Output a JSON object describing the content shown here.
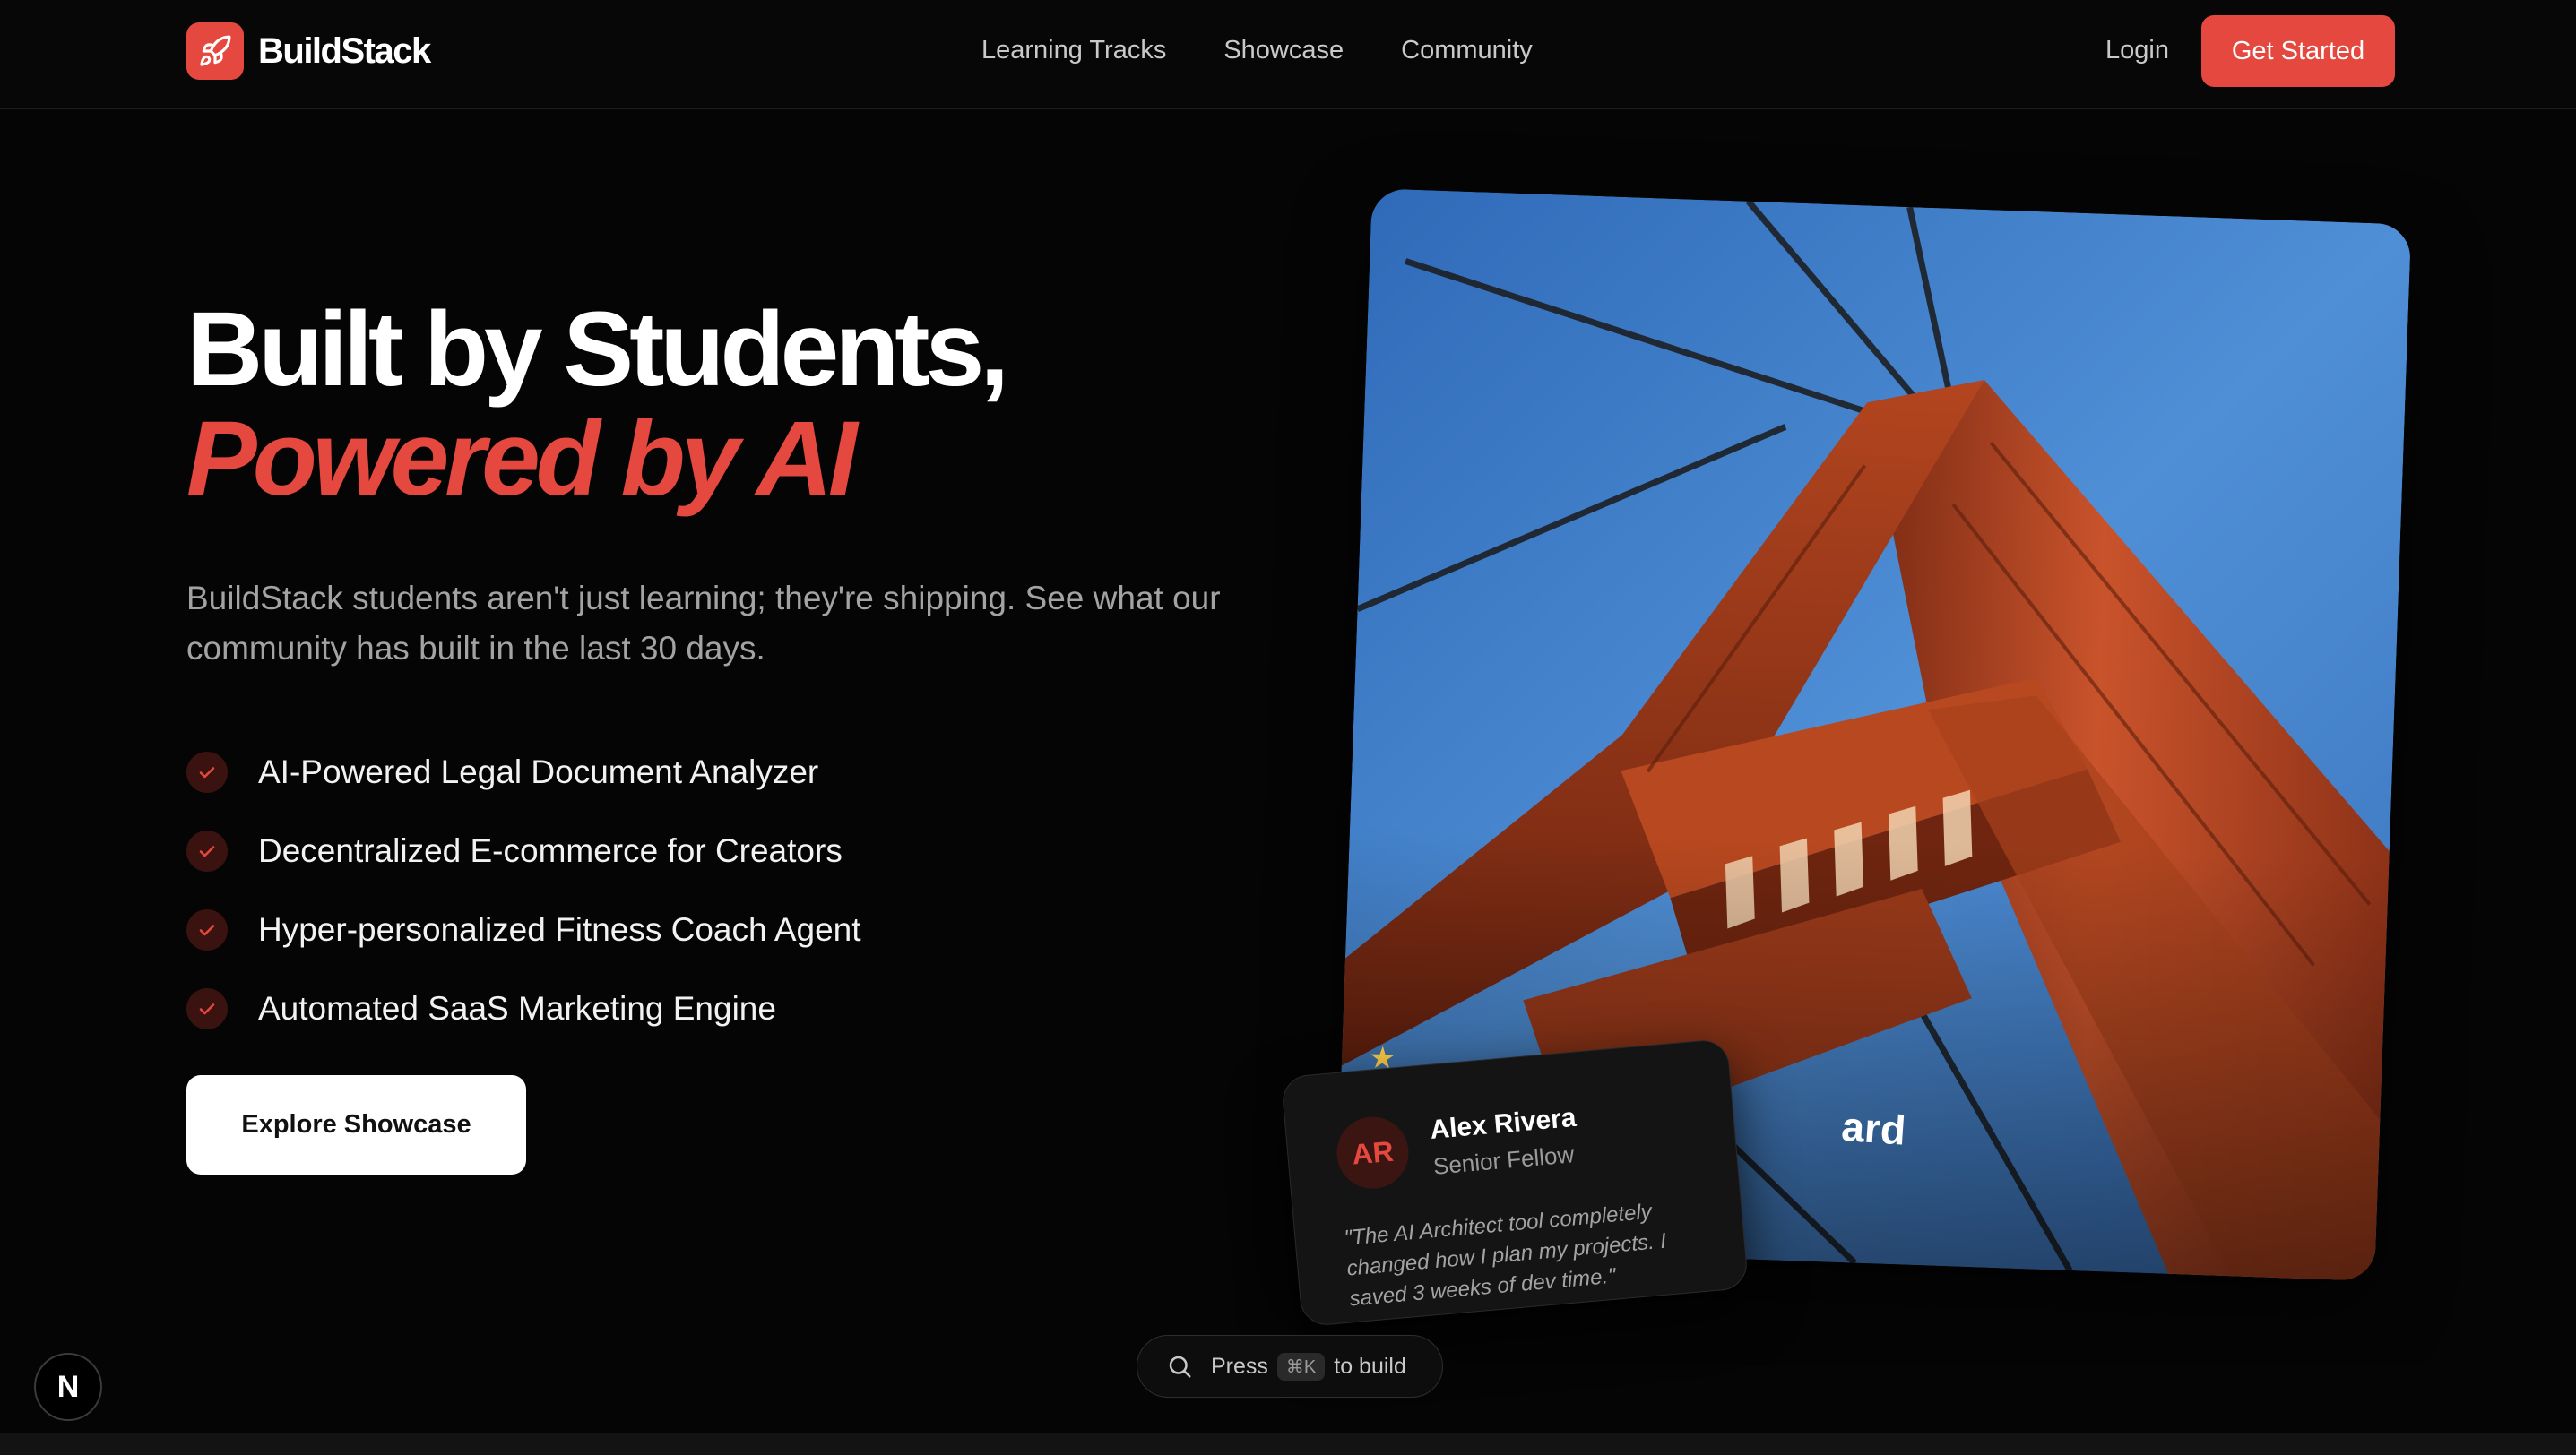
{
  "nav": {
    "brand": "BuildStack",
    "links": [
      "Learning Tracks",
      "Showcase",
      "Community"
    ],
    "login": "Login",
    "cta": "Get Started"
  },
  "hero": {
    "headline_line1": "Built by Students,",
    "headline_line2": "Powered by AI",
    "subtext": "BuildStack students aren't just learning; they're shipping. See what our community has built in the last 30 days.",
    "features": [
      "AI-Powered Legal Document Analyzer",
      "Decentralized E-commerce for Creators",
      "Hyper-personalized Fitness Coach Agent",
      "Automated SaaS Marketing Engine"
    ],
    "explore_button": "Explore Showcase"
  },
  "showcase_card": {
    "title_fragment": "ard"
  },
  "testimonial": {
    "initials": "AR",
    "name": "Alex Rivera",
    "role": "Senior Fellow",
    "quote": "\"The AI Architect tool completely changed how I plan my projects. I saved 3 weeks of dev time.\""
  },
  "command_bar": {
    "prefix": "Press",
    "shortcut": "⌘K",
    "suffix": "to build"
  },
  "dev_badge": "N",
  "colors": {
    "accent": "#e5483f",
    "background": "#050505",
    "muted_text": "#a3a3a3"
  },
  "icons": [
    "rocket-icon",
    "check-icon",
    "search-icon",
    "star-icon"
  ]
}
